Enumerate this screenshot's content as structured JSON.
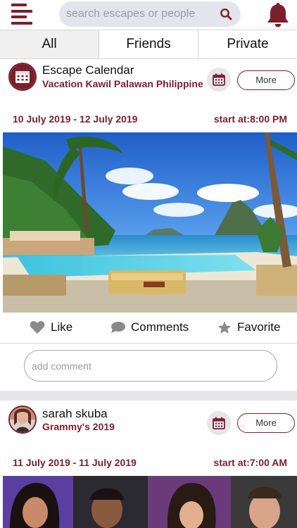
{
  "header": {
    "search_placeholder": "search escapes or people"
  },
  "tabs": [
    {
      "label": "All"
    },
    {
      "label": "Friends"
    },
    {
      "label": "Private"
    }
  ],
  "posts": [
    {
      "name": "Escape Calendar",
      "subtitle": "Vacation Kawil Palawan Philippine",
      "more_label": "More",
      "date_range": "10 July 2019 - 12 July 2019",
      "start": "start at:8:00 PM",
      "actions": {
        "like": "Like",
        "comments": "Comments",
        "favorite": "Favorite"
      },
      "comment_placeholder": "add comment"
    },
    {
      "name": "sarah skuba",
      "subtitle": "Grammy's 2019",
      "more_label": "More",
      "date_range": "11 July 2019 - 11 July 2019",
      "start": "start at:7:00 AM"
    }
  ],
  "colors": {
    "accent": "#7a1f2b",
    "tab_active_bg": "#f0f0f0",
    "search_bg": "#e4e4ec"
  }
}
